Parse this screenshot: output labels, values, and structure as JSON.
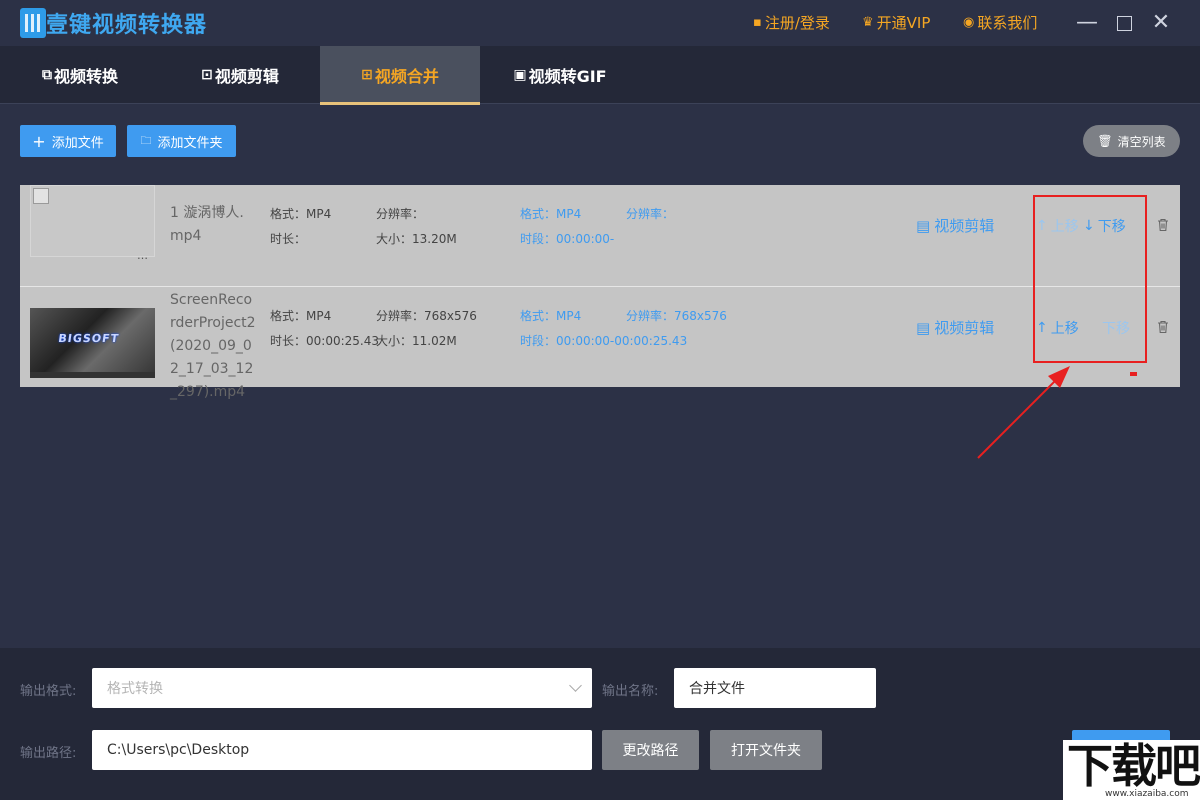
{
  "app": {
    "title": "壹键视频转换器"
  },
  "top_links": {
    "register": "注册/登录",
    "vip": "开通VIP",
    "contact": "联系我们"
  },
  "tabs": [
    {
      "label": "视频转换"
    },
    {
      "label": "视频剪辑"
    },
    {
      "label": "视频合并"
    },
    {
      "label": "视频转GIF"
    }
  ],
  "toolbar": {
    "add_file": "添加文件",
    "add_folder": "添加文件夹",
    "clear_list": "清空列表"
  },
  "files": [
    {
      "name_lines": [
        "1 漩涡博人.",
        "mp4"
      ],
      "src_format": "格式：MP4",
      "src_resolution": "分辨率：",
      "src_duration": "时长：",
      "src_size": "大小：13.20M",
      "out_format": "格式：MP4",
      "out_resolution": "分辨率：",
      "out_segment": "时段：00:00:00-",
      "edit": "视频剪辑",
      "move_up": "上移",
      "move_down": "下移",
      "thumb_dots": "…"
    },
    {
      "name_lines": [
        "ScreenReco",
        "rderProject2",
        "(2020_09_0",
        "2_17_03_12",
        "_297).mp4"
      ],
      "src_format": "格式：MP4",
      "src_resolution": "分辨率：768x576",
      "src_duration": "时长：00:00:25.43",
      "src_size": "大小：11.02M",
      "out_format": "格式：MP4",
      "out_resolution": "分辨率：768x576",
      "out_segment": "时段：00:00:00-00:00:25.43",
      "edit": "视频剪辑",
      "move_up": "上移",
      "move_down": "下移",
      "thumb_text": "BIGSOFT"
    }
  ],
  "output": {
    "format_label": "输出格式:",
    "format_placeholder": "格式转换",
    "name_label": "输出名称:",
    "name_value": "合并文件",
    "path_label": "输出路径:",
    "path_value": "C:\\Users\\pc\\Desktop",
    "change_path": "更改路径",
    "open_folder": "打开文件夹"
  },
  "watermark": {
    "text": "下载吧",
    "url": "www.xiazaiba.com"
  },
  "colors": {
    "accent": "#3f9bf0",
    "gold": "#f5a623",
    "annotation": "#e82020"
  }
}
